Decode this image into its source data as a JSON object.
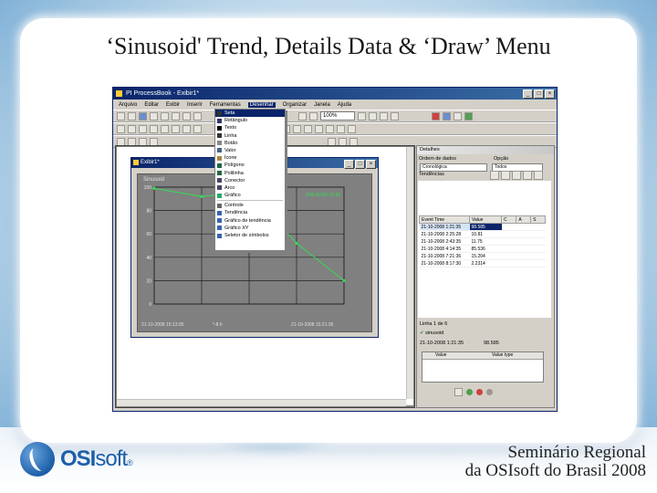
{
  "slide": {
    "title": "‘Sinusoid' Trend, Details Data & ‘Draw’ Menu",
    "footer_line1": "Seminário Regional",
    "footer_line2": "da OSIsoft do Brasil 2008",
    "logo_text": "OSI",
    "logo_text2": "soft",
    "logo_reg": "®"
  },
  "app": {
    "title": "PI ProcessBook - Exibir1*",
    "window_buttons": [
      "_",
      "□",
      "×"
    ],
    "menu": [
      "Arquivo",
      "Editar",
      "Exibir",
      "Inserir",
      "Ferramentas",
      "Desenhar",
      "Organizar",
      "Janela",
      "Ajuda"
    ],
    "active_menu_index": 5,
    "zoom": "100%"
  },
  "draw_menu": {
    "items": [
      "Seta",
      "Retângulo",
      "Texto",
      "Linha",
      "Botão",
      "Valor",
      "Ícone",
      "Polígono",
      "Polilinha",
      "Conector",
      "Arco",
      "Gráfico",
      "Controle",
      "Tendência",
      "Gráfico de tendência",
      "Gráfico XY",
      "Seletor de símbolos"
    ],
    "selected_index": 0
  },
  "display": {
    "title": "Exibir1*",
    "trend_name": "Sinusoid",
    "legend": "SINUSOID  19.88",
    "start_time": "21-10-2008 15:13:35",
    "duration": "*-8 h",
    "end_time": "21-10-2008 15:21:35"
  },
  "details": {
    "panel_title": "Detalhes",
    "sort_label": "Ordem de dados",
    "option_label": "Opção",
    "sort_value": "Cronológica",
    "option_value": "Todos",
    "trends_label": "Tendências",
    "columns": [
      "Event Time",
      "Value",
      "C",
      "A",
      "S"
    ],
    "rows": [
      {
        "time": "21-10-2008 1:21:35",
        "value": "98.585"
      },
      {
        "time": "21-10-2008 2:25:28",
        "value": "10.81"
      },
      {
        "time": "21-10-2008 2:43:35",
        "value": "11.75"
      },
      {
        "time": "21-10-2008 4:14:35",
        "value": "85.536"
      },
      {
        "time": "21-10-2008 7:21:36",
        "value": "15.204"
      },
      {
        "time": "21-10-2008 8:17:30",
        "value": "2.2314"
      }
    ],
    "lower_title": "Linha 1 de 6",
    "lower_tag": "sinusoid",
    "lower_time": "21-10-2008 1:21:35",
    "lower_value": "98.585",
    "grid_columns": [
      "Value",
      "Value type"
    ]
  },
  "chart_data": {
    "type": "line",
    "x": [
      "15:13:35",
      "15:15:35",
      "15:17:35",
      "15:19:35",
      "15:21:35"
    ],
    "series": [
      {
        "name": "SINUSOID",
        "values": [
          99,
          92,
          96,
          52,
          20
        ],
        "color": "#33dd55"
      }
    ],
    "y_ticks": [
      0,
      20,
      40,
      60,
      80,
      100
    ],
    "ylim": [
      0,
      100
    ],
    "grid": true,
    "legend_placement": "top-right"
  }
}
